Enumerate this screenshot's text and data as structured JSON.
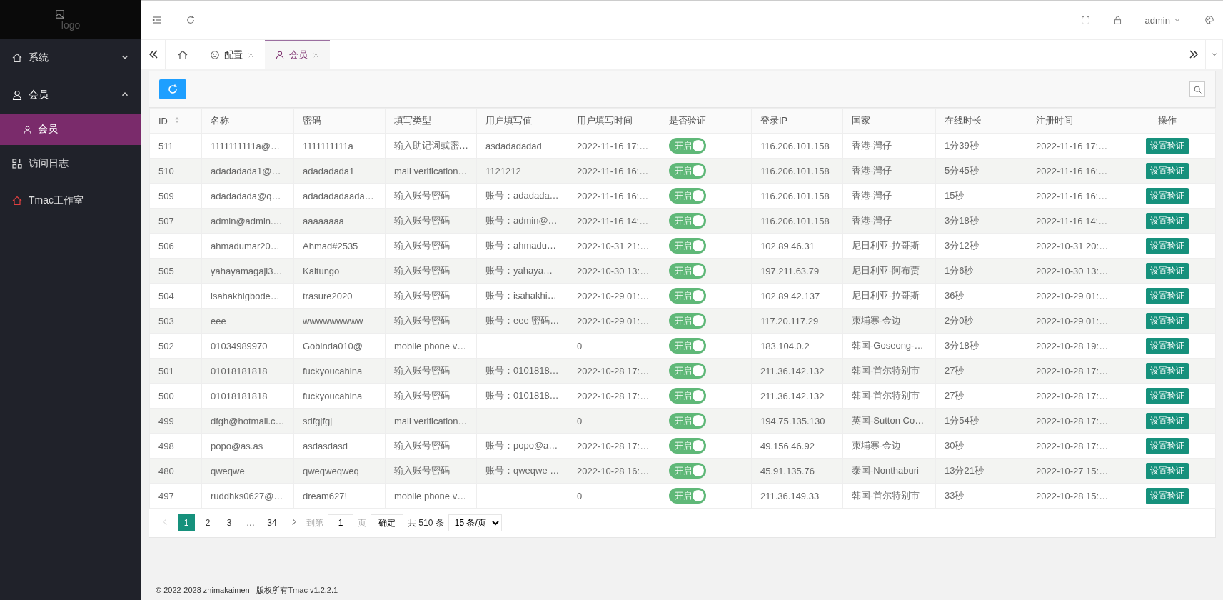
{
  "logo": {
    "alt": "logo"
  },
  "sidebar": {
    "items": [
      {
        "label": "系统",
        "expanded": false
      },
      {
        "label": "会员",
        "expanded": true,
        "children": [
          {
            "label": "会员",
            "selected": true
          }
        ]
      },
      {
        "label": "访问日志"
      },
      {
        "label": "Tmac工作室"
      }
    ]
  },
  "topbar": {
    "user": "admin"
  },
  "tabs": [
    {
      "kind": "home",
      "selected": false
    },
    {
      "kind": "page",
      "label": "配置",
      "selected": false
    },
    {
      "kind": "page",
      "label": "会员",
      "selected": true
    }
  ],
  "table": {
    "columns": [
      {
        "label": "ID",
        "sortable": true
      },
      {
        "label": "名称",
        "sortable": false
      },
      {
        "label": "密码",
        "sortable": false
      },
      {
        "label": "填写类型",
        "sortable": false
      },
      {
        "label": "用户填写值",
        "sortable": false
      },
      {
        "label": "用户填写时间",
        "sortable": false
      },
      {
        "label": "是否验证",
        "sortable": false
      },
      {
        "label": "登录IP",
        "sortable": false
      },
      {
        "label": "国家",
        "sortable": false
      },
      {
        "label": "在线时长",
        "sortable": false
      },
      {
        "label": "注册时间",
        "sortable": false
      },
      {
        "label": "操作",
        "sortable": false
      }
    ],
    "rows": [
      {
        "cells": [
          "511",
          "1111111111a@…",
          "1111111111a",
          "输入助记词或密…",
          "asdadadadad",
          "2022-11-16 17:…"
        ],
        "verified": true,
        "toggle_label": "开启",
        "rest": [
          "116.206.101.158",
          "香港-灣仔",
          "1分39秒",
          "2022-11-16 17:…"
        ],
        "action": "设置验证"
      },
      {
        "cells": [
          "510",
          "adadadada1@…",
          "adadadada1",
          "mail verification…",
          "1121212",
          "2022-11-16 16:…"
        ],
        "verified": true,
        "toggle_label": "开启",
        "rest": [
          "116.206.101.158",
          "香港-灣仔",
          "5分45秒",
          "2022-11-16 16:…"
        ],
        "action": "设置验证"
      },
      {
        "cells": [
          "509",
          "adadadada@q…",
          "adadadadaada…",
          "输入账号密码",
          "账号：adadada…",
          "2022-11-16 16:…"
        ],
        "verified": true,
        "toggle_label": "开启",
        "rest": [
          "116.206.101.158",
          "香港-灣仔",
          "15秒",
          "2022-11-16 16:…"
        ],
        "action": "设置验证"
      },
      {
        "cells": [
          "507",
          "admin@admin.…",
          "aaaaaaaa",
          "输入账号密码",
          "账号：admin@…",
          "2022-11-16 14:…"
        ],
        "verified": true,
        "toggle_label": "开启",
        "rest": [
          "116.206.101.158",
          "香港-灣仔",
          "3分18秒",
          "2022-11-16 14:…"
        ],
        "action": "设置验证"
      },
      {
        "cells": [
          "506",
          "ahmadumar20…",
          "Ahmad#2535",
          "输入账号密码",
          "账号：ahmadu…",
          "2022-10-31 21:…"
        ],
        "verified": true,
        "toggle_label": "开启",
        "rest": [
          "102.89.46.31",
          "尼日利亚-拉哥斯",
          "3分12秒",
          "2022-10-31 20:…"
        ],
        "action": "设置验证"
      },
      {
        "cells": [
          "505",
          "yahayamagaji3…",
          "Kaltungo",
          "输入账号密码",
          "账号：yahaya…",
          "2022-10-30 13:…"
        ],
        "verified": true,
        "toggle_label": "开启",
        "rest": [
          "197.211.63.79",
          "尼日利亚-阿布贾",
          "1分6秒",
          "2022-10-30 13:…"
        ],
        "action": "设置验证"
      },
      {
        "cells": [
          "504",
          "isahakhigbode…",
          "trasure2020",
          "输入账号密码",
          "账号：isahakhi…",
          "2022-10-29 01:…"
        ],
        "verified": true,
        "toggle_label": "开启",
        "rest": [
          "102.89.42.137",
          "尼日利亚-拉哥斯",
          "36秒",
          "2022-10-29 01:…"
        ],
        "action": "设置验证"
      },
      {
        "cells": [
          "503",
          "eee",
          "wwwwwwwww",
          "输入账号密码",
          "账号：eee 密码…",
          "2022-10-29 01:…"
        ],
        "verified": true,
        "toggle_label": "开启",
        "rest": [
          "117.20.117.29",
          "柬埔寨-金边",
          "2分0秒",
          "2022-10-29 01:…"
        ],
        "action": "设置验证"
      },
      {
        "cells": [
          "502",
          "01034989970",
          "Gobinda010@",
          "mobile phone v…",
          "",
          "0"
        ],
        "verified": true,
        "toggle_label": "开启",
        "rest": [
          "183.104.0.2",
          "韩国-Goseong-…",
          "3分18秒",
          "2022-10-28 19:…"
        ],
        "action": "设置验证"
      },
      {
        "cells": [
          "501",
          "01018181818",
          "fuckyoucahina",
          "输入账号密码",
          "账号：0101818…",
          "2022-10-28 17:…"
        ],
        "verified": true,
        "toggle_label": "开启",
        "rest": [
          "211.36.142.132",
          "韩国-首尔特别市",
          "27秒",
          "2022-10-28 17:…"
        ],
        "action": "设置验证"
      },
      {
        "cells": [
          "500",
          "01018181818",
          "fuckyoucahina",
          "输入账号密码",
          "账号：0101818…",
          "2022-10-28 17:…"
        ],
        "verified": true,
        "toggle_label": "开启",
        "rest": [
          "211.36.142.132",
          "韩国-首尔特别市",
          "27秒",
          "2022-10-28 17:…"
        ],
        "action": "设置验证"
      },
      {
        "cells": [
          "499",
          "dfgh@hotmail.c…",
          "sdfgjfgj",
          "mail verification…",
          "",
          "0"
        ],
        "verified": true,
        "toggle_label": "开启",
        "rest": [
          "194.75.135.130",
          "英国-Sutton Co…",
          "1分54秒",
          "2022-10-28 17:…"
        ],
        "action": "设置验证"
      },
      {
        "cells": [
          "498",
          "popo@as.as",
          "asdasdasd",
          "输入账号密码",
          "账号：popo@a…",
          "2022-10-28 17:…"
        ],
        "verified": true,
        "toggle_label": "开启",
        "rest": [
          "49.156.46.92",
          "柬埔寨-金边",
          "30秒",
          "2022-10-28 17:…"
        ],
        "action": "设置验证"
      },
      {
        "cells": [
          "480",
          "qweqwe",
          "qweqweqweq",
          "输入账号密码",
          "账号：qweqwe …",
          "2022-10-28 16:…"
        ],
        "verified": true,
        "toggle_label": "开启",
        "rest": [
          "45.91.135.76",
          "泰国-Nonthaburi",
          "13分21秒",
          "2022-10-27 15:…"
        ],
        "action": "设置验证"
      },
      {
        "cells": [
          "497",
          "ruddhks0627@…",
          "dream627!",
          "mobile phone v…",
          "",
          "0"
        ],
        "verified": true,
        "toggle_label": "开启",
        "rest": [
          "211.36.149.33",
          "韩国-首尔特别市",
          "33秒",
          "2022-10-28 15:…"
        ],
        "action": "设置验证"
      }
    ]
  },
  "pagination": {
    "pages": [
      {
        "label": "1",
        "selected": true
      },
      {
        "label": "2",
        "selected": false
      },
      {
        "label": "3",
        "selected": false
      },
      {
        "label": "…",
        "selected": false
      },
      {
        "label": "34",
        "selected": false
      }
    ],
    "goto_label": "到第",
    "goto_value": "1",
    "page_unit": "页",
    "confirm": "确定",
    "total": "共 510 条",
    "page_size": "15 条/页"
  },
  "footer": "© 2022-2028 zhimakaimen - 版权所有Tmac v1.2.2.1"
}
